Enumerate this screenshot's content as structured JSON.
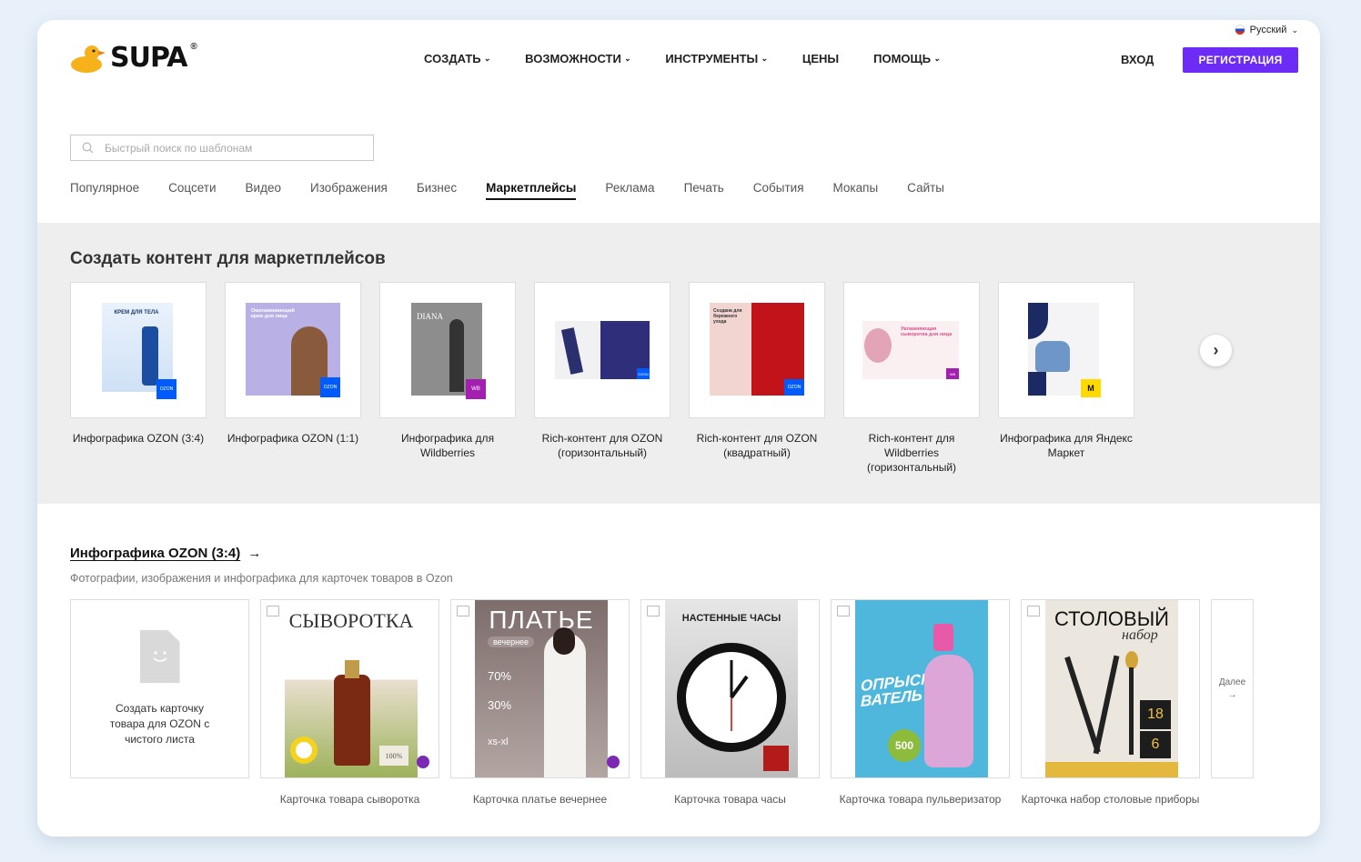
{
  "header": {
    "language": "Русский",
    "logo_text": "SUPA",
    "logo_mark": "®",
    "nav": [
      {
        "label": "СОЗДАТЬ",
        "dropdown": true
      },
      {
        "label": "ВОЗМОЖНОСТИ",
        "dropdown": true
      },
      {
        "label": "ИНСТРУМЕНТЫ",
        "dropdown": true
      },
      {
        "label": "ЦЕНЫ",
        "dropdown": false
      },
      {
        "label": "ПОМОЩЬ",
        "dropdown": true
      }
    ],
    "login": "ВХОД",
    "signup": "РЕГИСТРАЦИЯ"
  },
  "search": {
    "placeholder": "Быстрый поиск по шаблонам"
  },
  "tabs": [
    "Популярное",
    "Соцсети",
    "Видео",
    "Изображения",
    "Бизнес",
    "Маркетплейсы",
    "Реклама",
    "Печать",
    "События",
    "Мокапы",
    "Сайты"
  ],
  "active_tab": "Маркетплейсы",
  "marketplace": {
    "title": "Создать контент для маркетплейсов",
    "cards": [
      {
        "label": "Инфографика OZON (3:4)",
        "thumb_text": "КРЕМ ДЛЯ ТЕЛА",
        "badge": "OZON"
      },
      {
        "label": "Инфографика OZON (1:1)",
        "thumb_text": "Омолаживающий крем для лица",
        "badge": "OZON"
      },
      {
        "label": "Инфографика для Wildberries",
        "thumb_text": "DIANA",
        "badge": "WB"
      },
      {
        "label": "Rich-контент для OZON (горизонтальный)",
        "thumb_text": "",
        "badge": "OZON"
      },
      {
        "label": "Rich-контент для OZON (квадратный)",
        "thumb_text": "Создана для бережного ухода",
        "badge": "OZON"
      },
      {
        "label": "Rich-контент для Wildberries (горизонтальный)",
        "thumb_text": "Увлажняющая сыворотка для лица",
        "badge": "WB"
      },
      {
        "label": "Инфографика для Яндекс Маркет",
        "thumb_text": "",
        "badge": "YM"
      }
    ]
  },
  "section": {
    "title": "Инфографика OZON (3:4)",
    "arrow": "→",
    "description": "Фотографии, изображения и инфографика для карточек товаров в Ozon",
    "blank_card": "Создать карточку товара для OZON с чистого листа",
    "templates": [
      {
        "label": "Карточка товара сыворотка",
        "poster_title": "СЫВОРОТКА",
        "stamp": "100%"
      },
      {
        "label": "Карточка платье вечернее",
        "poster_title": "ПЛАТЬЕ",
        "tag": "вечернее",
        "stats": [
          "70%",
          "30%",
          "xs-xl"
        ]
      },
      {
        "label": "Карточка товара часы",
        "poster_title": "НАСТЕННЫЕ ЧАСЫ"
      },
      {
        "label": "Карточка товара пульверизатор",
        "poster_title": "ОПРЫСКИ-ВАТЕЛЬ",
        "badge_num": "500"
      },
      {
        "label": "Карточка набор столовые приборы",
        "poster_title": "СТОЛОВЫЙ",
        "poster_sub": "набор",
        "nums": [
          "18",
          "6"
        ]
      }
    ],
    "more": "Далее"
  },
  "colors": {
    "accent": "#6c2cf5",
    "ozon": "#005bff",
    "wb": "#a21faf"
  }
}
